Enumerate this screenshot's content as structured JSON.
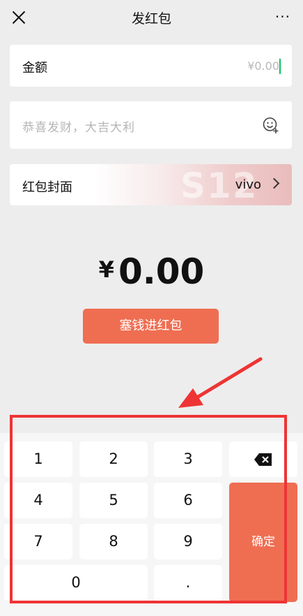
{
  "header": {
    "title": "发红包",
    "more": "···"
  },
  "amount": {
    "label": "金额",
    "value": "¥0.00"
  },
  "wish": {
    "placeholder": "恭喜发财，大吉大利"
  },
  "cover": {
    "label": "红包封面",
    "watermark": "S12",
    "brand": "vivo"
  },
  "display": {
    "currency": "¥",
    "amount": "0.00"
  },
  "submit": {
    "label": "塞钱进红包"
  },
  "keypad": {
    "keys": [
      "1",
      "2",
      "3",
      "4",
      "5",
      "6",
      "7",
      "8",
      "9",
      "0",
      "."
    ],
    "confirm": "确定"
  },
  "colors": {
    "accent": "#ef6e52",
    "highlight": "#ee3434",
    "caret": "#07c160"
  }
}
